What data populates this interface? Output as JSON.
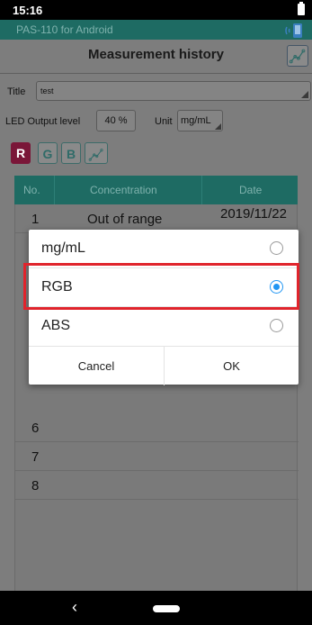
{
  "status_bar": {
    "time": "15:16"
  },
  "app_bar": {
    "app_name": "PAS-110 for Android",
    "icon": "bluetooth-phone-icon"
  },
  "screen": {
    "title": "Measurement history",
    "title_field_label": "Title",
    "title_field_value": "test",
    "led_label": "LED Output level",
    "led_value": "40 %",
    "unit_label": "Unit",
    "unit_value": "mg/mL",
    "channels": [
      {
        "label": "R",
        "active": true
      },
      {
        "label": "G",
        "active": false
      },
      {
        "label": "B",
        "active": false
      }
    ]
  },
  "table": {
    "columns": [
      "No.",
      "Concentration",
      "Date"
    ],
    "rows": [
      {
        "no": "1",
        "concentration": "Out of range",
        "date": "2019/11/22"
      },
      {
        "no": "6",
        "concentration": "",
        "date": ""
      },
      {
        "no": "7",
        "concentration": "",
        "date": ""
      },
      {
        "no": "8",
        "concentration": "",
        "date": ""
      }
    ]
  },
  "dialog": {
    "options": [
      {
        "label": "mg/mL",
        "selected": false
      },
      {
        "label": "RGB",
        "selected": true
      },
      {
        "label": "ABS",
        "selected": false
      }
    ],
    "cancel_label": "Cancel",
    "ok_label": "OK"
  },
  "nav_bar": {
    "back_glyph": "‹"
  },
  "colors": {
    "accent": "#2196f3",
    "highlight": "#e0242c",
    "app_teal": "#1e6b63",
    "r_button": "#7a1638"
  }
}
